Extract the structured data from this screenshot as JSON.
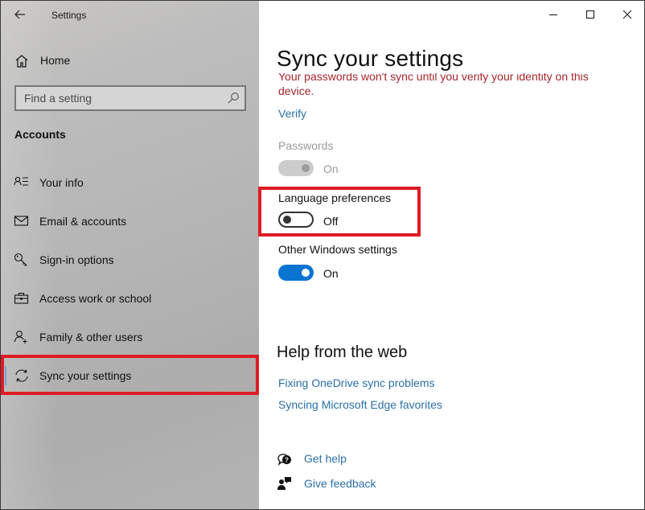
{
  "window": {
    "app_title": "Settings",
    "caption_buttons": [
      "minimize",
      "maximize",
      "close"
    ]
  },
  "sidebar": {
    "home_label": "Home",
    "search": {
      "placeholder": "Find a setting",
      "value": ""
    },
    "section_heading": "Accounts",
    "items": [
      {
        "label": "Your info",
        "icon": "contact-info-icon",
        "active": false
      },
      {
        "label": "Email & accounts",
        "icon": "mail-icon",
        "active": false
      },
      {
        "label": "Sign-in options",
        "icon": "key-icon",
        "active": false
      },
      {
        "label": "Access work or school",
        "icon": "briefcase-icon",
        "active": false
      },
      {
        "label": "Family & other users",
        "icon": "add-person-icon",
        "active": false
      },
      {
        "label": "Sync your settings",
        "icon": "sync-icon",
        "active": true
      }
    ],
    "highlighted_item": "Sync your settings"
  },
  "main": {
    "page_title": "Sync your settings",
    "warning_text": "Your passwords won't sync until you verify your identity on this device.",
    "verify_link": "Verify",
    "settings": [
      {
        "label": "Passwords",
        "state": "On",
        "on": true,
        "disabled": true
      },
      {
        "label": "Language preferences",
        "state": "Off",
        "on": false,
        "disabled": false,
        "highlighted": true
      },
      {
        "label": "Other Windows settings",
        "state": "On",
        "on": true,
        "disabled": false
      }
    ],
    "help": {
      "title": "Help from the web",
      "links": [
        "Fixing OneDrive sync problems",
        "Syncing Microsoft Edge favorites"
      ]
    },
    "actions": [
      {
        "label": "Get help",
        "icon": "get-help-icon"
      },
      {
        "label": "Give feedback",
        "icon": "feedback-icon"
      }
    ]
  },
  "colors": {
    "accent": "#0a74d1",
    "link": "#2b6fa8",
    "warning": "#a4262c",
    "annotation_box": "#e01b24"
  }
}
